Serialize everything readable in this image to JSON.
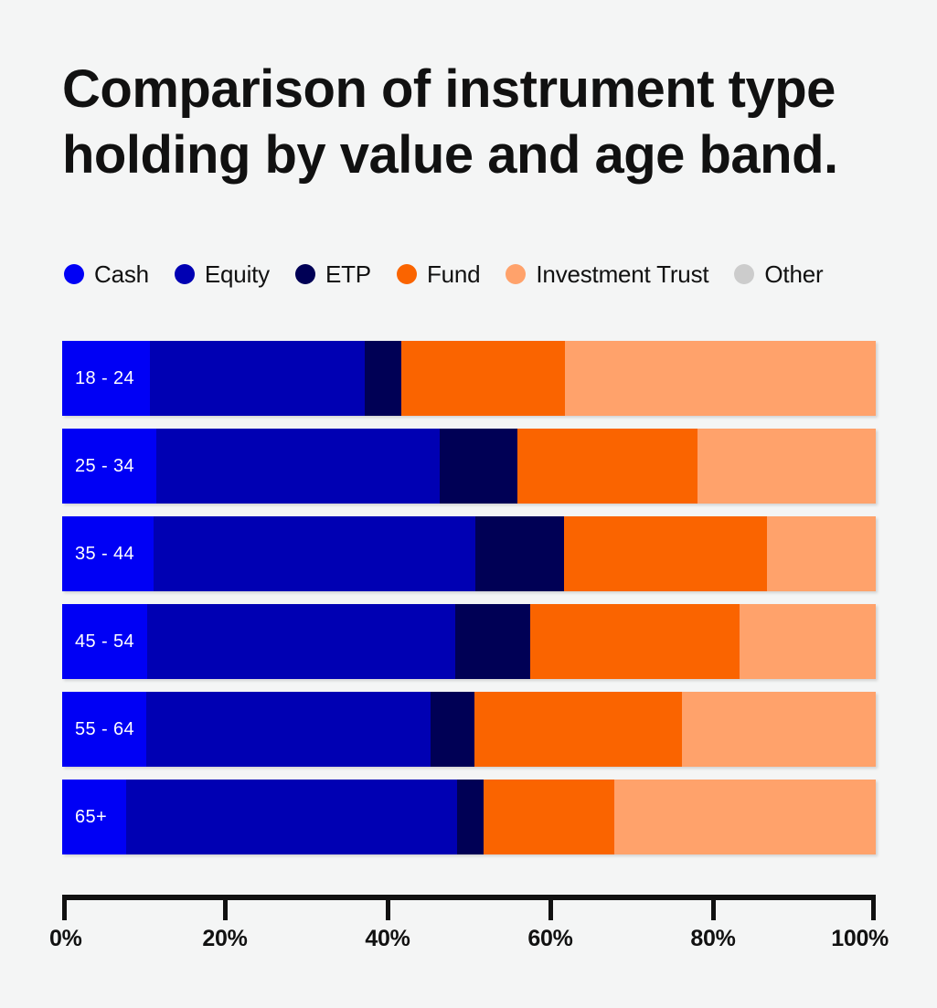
{
  "title": "Comparison of instrument type\nholding by value and age band.",
  "legend": {
    "position": "top-left",
    "items": [
      {
        "label": "Cash",
        "color": "#0000f5",
        "icon": "circle-swatch-icon"
      },
      {
        "label": "Equity",
        "color": "#0000b3",
        "icon": "circle-swatch-icon"
      },
      {
        "label": "ETP",
        "color": "#000055",
        "icon": "circle-swatch-icon"
      },
      {
        "label": "Fund",
        "color": "#fa6400",
        "icon": "circle-swatch-icon"
      },
      {
        "label": "Investment Trust",
        "color": "#ffa26b",
        "icon": "circle-swatch-icon"
      },
      {
        "label": "Other",
        "color": "#cccccc",
        "icon": "circle-swatch-icon"
      }
    ]
  },
  "axis": {
    "ticks": [
      "0%",
      "20%",
      "40%",
      "60%",
      "80%",
      "100%"
    ],
    "tick_values": [
      0,
      20,
      40,
      60,
      80,
      100
    ],
    "min": 0,
    "max": 100
  },
  "colors": {
    "background": "#f4f5f5",
    "text": "#111111",
    "bar_label": "#ffffff"
  },
  "chart_data": {
    "type": "bar",
    "orientation": "horizontal",
    "stacked": true,
    "normalized_percent": true,
    "title": "Comparison of instrument type holding by value and age band.",
    "xlabel": "",
    "ylabel": "",
    "xlim": [
      0,
      100
    ],
    "grid": false,
    "legend_position": "top-left",
    "categories": [
      "18 - 24",
      "25 - 34",
      "35 - 44",
      "45 - 54",
      "55 - 64",
      "65+"
    ],
    "series": [
      {
        "name": "Cash",
        "color": "#0000f5",
        "values": [
          10.8,
          11.6,
          11.2,
          10.5,
          10.3,
          7.9
        ]
      },
      {
        "name": "Equity",
        "color": "#0000b3",
        "values": [
          26.4,
          34.8,
          39.6,
          37.8,
          35.0,
          40.6
        ]
      },
      {
        "name": "ETP",
        "color": "#000055",
        "values": [
          4.5,
          9.6,
          10.9,
          9.2,
          5.4,
          3.3
        ]
      },
      {
        "name": "Fund",
        "color": "#fa6400",
        "values": [
          20.1,
          22.1,
          24.9,
          25.8,
          25.5,
          16.1
        ]
      },
      {
        "name": "Investment Trust",
        "color": "#ffa26b",
        "values": [
          38.2,
          21.9,
          13.4,
          16.7,
          23.8,
          32.1
        ]
      },
      {
        "name": "Other",
        "color": "#cccccc",
        "values": [
          0,
          0,
          0,
          0,
          0,
          0
        ]
      }
    ]
  }
}
